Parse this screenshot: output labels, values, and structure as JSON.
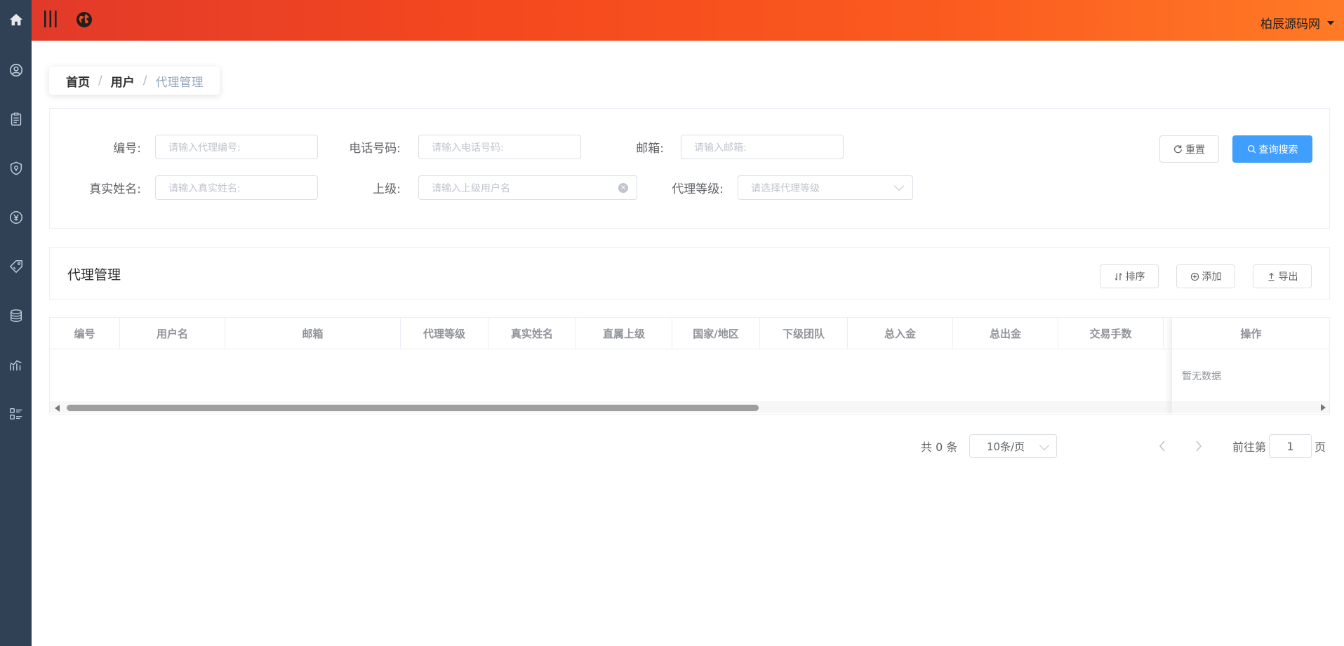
{
  "header": {
    "user_name": "柏辰源码网"
  },
  "sidebar": {
    "icons": [
      "home-icon",
      "user-circle-icon",
      "clipboard-icon",
      "shield-icon",
      "yen-icon",
      "tag-icon",
      "coins-icon",
      "chart-icon",
      "list-icon"
    ]
  },
  "breadcrumb": {
    "home": "首页",
    "user": "用户",
    "current": "代理管理",
    "separator": "/"
  },
  "search": {
    "id_label": "编号:",
    "id_placeholder": "请输入代理编号:",
    "phone_label": "电话号码:",
    "phone_placeholder": "请输入电话号码:",
    "email_label": "邮箱:",
    "email_placeholder": "请输入邮箱:",
    "name_label": "真实姓名:",
    "name_placeholder": "请输入真实姓名:",
    "parent_label": "上级:",
    "parent_placeholder": "请输入上级用户名",
    "level_label": "代理等级:",
    "level_placeholder": "请选择代理等级",
    "reset_label": "重置",
    "search_label": "查询搜索"
  },
  "table_panel": {
    "title": "代理管理",
    "sort_label": "排序",
    "add_label": "添加",
    "export_label": "导出"
  },
  "table": {
    "columns": [
      "编号",
      "用户名",
      "邮箱",
      "代理等级",
      "真实姓名",
      "直属上级",
      "国家/地区",
      "下级团队",
      "总入金",
      "总出金",
      "交易手数"
    ],
    "action_column": "操作",
    "empty_text": "暂无数据"
  },
  "pagination": {
    "total_label": "共 0 条",
    "page_size": "10条/页",
    "goto_prefix": "前往第",
    "goto_value": "1",
    "goto_suffix": "页"
  },
  "colors": {
    "sidebar_bg": "#304156",
    "primary": "#409eff",
    "header_start": "#e23a2a",
    "header_end": "#ff7a26"
  }
}
